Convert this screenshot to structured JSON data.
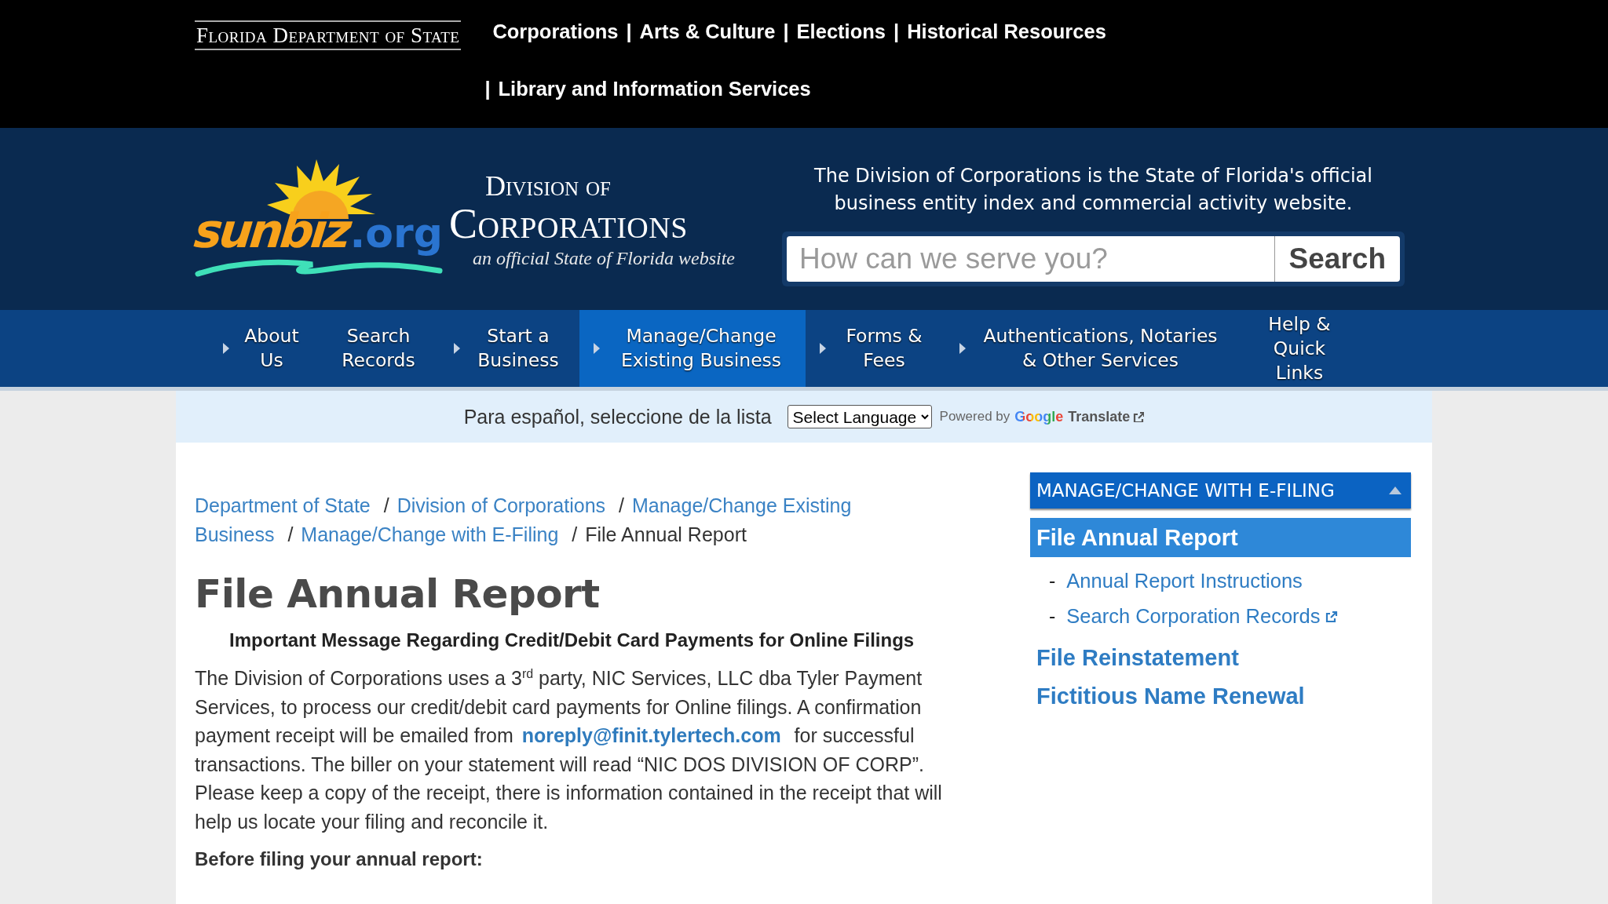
{
  "top_bar": {
    "logo": "Florida Department of State",
    "links": [
      {
        "label": "Corporations",
        "divider": "|"
      },
      {
        "label": "Arts & Culture",
        "divider": "|"
      },
      {
        "label": "Elections",
        "divider": "|"
      },
      {
        "label": "Historical Resources"
      }
    ],
    "second_row": {
      "divider": "|",
      "label": "Library and Information Services"
    }
  },
  "header": {
    "logo": {
      "sunbiz": "sunbiz",
      ".org": ".org",
      "division": "Division of",
      "corporations": "Corporations",
      "tagline": "an official State of Florida website"
    },
    "intro": "The Division of Corporations is the State of Florida's official business entity index and commercial activity website.",
    "search": {
      "placeholder": "How can we serve you?",
      "button": "Search"
    }
  },
  "nav": [
    {
      "label": "About Us",
      "arrow": true,
      "selected": false
    },
    {
      "label": "Search Records",
      "arrow": false,
      "selected": false
    },
    {
      "label": "Start a Business",
      "arrow": true,
      "selected": false
    },
    {
      "label": "Manage/Change Existing Business",
      "arrow": true,
      "selected": true
    },
    {
      "label": "Forms & Fees",
      "arrow": true,
      "selected": false
    },
    {
      "label": "Authentications, Notaries & Other Services",
      "arrow": true,
      "selected": false
    },
    {
      "label": "Help & Quick Links",
      "arrow": false,
      "selected": false
    }
  ],
  "language_bar": {
    "prompt": "Para español, seleccione de la lista",
    "select": "Select Language",
    "powered_by": "Powered by",
    "google": "Google",
    "translate": "Translate"
  },
  "breadcrumb": [
    {
      "label": "Department of State",
      "current": false
    },
    {
      "separator": "/",
      "label": "Division of Corporations",
      "current": false
    },
    {
      "separator": "/",
      "lines": [
        "Manage/Change Existing",
        "Business"
      ],
      "current": false
    },
    {
      "separator": "/",
      "label": "Manage/Change with E-Filing",
      "current": false
    },
    {
      "separator": "/",
      "label": "File Annual Report",
      "current": true
    }
  ],
  "title": "File Annual Report",
  "notice_heading": "Important Message Regarding Credit/Debit Card Payments for Online Filings",
  "notice": {
    "before": "The Division of Corporations uses a 3$^{rd}$ party, NIC Services, LLC dba Tyler Payment Services, to process our credit/debit card payments for Online filings. A confirmation payment receipt will be emailed from ",
    "email": "noreply@finit.tylertech.com",
    "after": " for successful transactions. The biller on your statement will read “NIC DOS DIVISION OF CORP”. Please keep a copy of the receipt, there is information contained in the receipt that will help us locate your filing and reconcile it."
  },
  "subheading": "Before filing your annual report:",
  "sidebar": {
    "heading": "MANAGE/CHANGE WITH E-FILING",
    "expanded": true,
    "items": [
      {
        "kind": "current",
        "label": "File Annual Report"
      },
      {
        "kind": "sub",
        "dash": "-",
        "label": "Annual Report Instructions",
        "external": false
      },
      {
        "kind": "sub",
        "dash": "-",
        "label": "Search Corporation Records",
        "external": true
      },
      {
        "kind": "main",
        "label": "File Reinstatement"
      },
      {
        "kind": "main",
        "label": "Fictitious Name Renewal"
      }
    ]
  }
}
